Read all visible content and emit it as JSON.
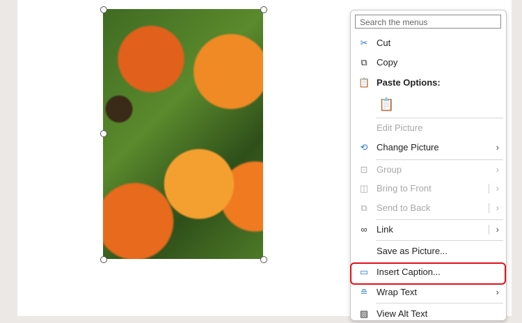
{
  "menu": {
    "search_placeholder": "Search the menus",
    "items": [
      {
        "label": "Cut",
        "icon": "scissors-icon"
      },
      {
        "label": "Copy",
        "icon": "copy-icon"
      },
      {
        "label": "Paste Options:",
        "icon": "paste-icon"
      },
      {
        "label": "Edit Picture"
      },
      {
        "label": "Change Picture",
        "icon": "change-picture-icon"
      },
      {
        "label": "Group",
        "icon": "group-icon"
      },
      {
        "label": "Bring to Front",
        "icon": "bring-front-icon"
      },
      {
        "label": "Send to Back",
        "icon": "send-back-icon"
      },
      {
        "label": "Link",
        "icon": "link-icon"
      },
      {
        "label": "Save as Picture..."
      },
      {
        "label": "Insert Caption...",
        "icon": "insert-caption-icon"
      },
      {
        "label": "Wrap Text",
        "icon": "wrap-text-icon"
      },
      {
        "label": "View Alt Text",
        "icon": "alt-text-icon"
      }
    ]
  },
  "highlight_color": "#e0101a"
}
